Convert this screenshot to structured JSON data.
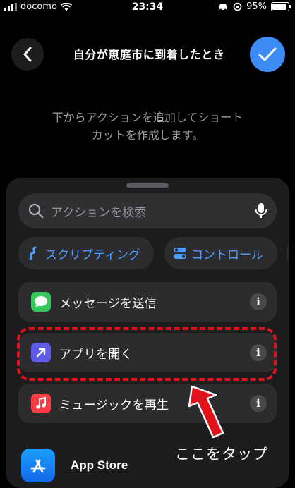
{
  "status_bar": {
    "carrier": "docomo",
    "time": "23:34",
    "battery": "95%",
    "battery_level": 0.95
  },
  "header": {
    "title": "自分が恵庭市に到着したとき"
  },
  "hint": {
    "line1": "下からアクションを追加してショート",
    "line2": "カットを作成します。"
  },
  "search": {
    "placeholder": "アクションを検索"
  },
  "categories": [
    {
      "label": "スクリプティング"
    },
    {
      "label": "コントロール"
    }
  ],
  "actions": [
    {
      "label": "メッセージを送信",
      "icon": "messages-icon",
      "color": "#34c759"
    },
    {
      "label": "アプリを開く",
      "icon": "open-app-icon",
      "color": "#5e5ce6"
    },
    {
      "label": "ミュージックを再生",
      "icon": "music-icon",
      "color": "#fc3c44"
    }
  ],
  "info_glyph": "i",
  "suggestion": {
    "label": "App Store",
    "icon": "app-store-icon"
  },
  "annotation": {
    "caption": "ここをタップ",
    "color": "#e0121b"
  }
}
